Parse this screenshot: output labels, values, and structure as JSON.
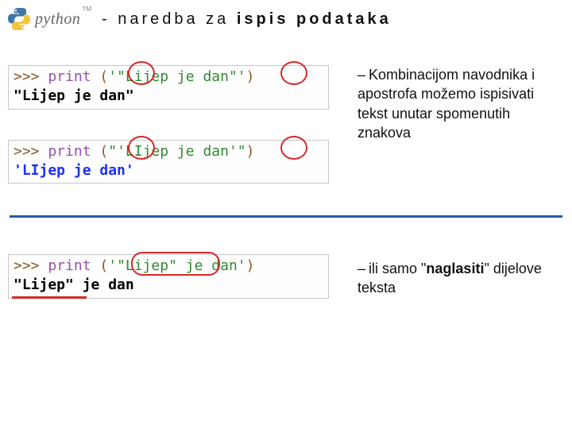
{
  "header": {
    "logo_word": "python",
    "tm": "TM",
    "title_before": "- naredba za ",
    "title_bold": "ispis podataka"
  },
  "code1": {
    "prompt": ">>> ",
    "kw": "print",
    "open": " (",
    "argA": "'\"Lijep je dan\"'",
    "close": ")",
    "outA": "\"Lijep je dan\"",
    "prompt2": ">>> ",
    "kw2": "print",
    "open2": " (",
    "argB": "\"'LIjep je dan'\"",
    "close2": ")",
    "outB": "'LIjep je dan'"
  },
  "note1": {
    "dash": "–",
    "body": "Kombinacijom navodnika i apostrofa možemo ispisivati tekst unutar spomenutih znakova"
  },
  "code2": {
    "prompt": ">>> ",
    "kw": "print",
    "open": " (",
    "argC": "'\"Lijep\" je dan'",
    "close": ")",
    "outC": "\"Lijep\" je dan"
  },
  "note2": {
    "dash": "–",
    "before": "ili samo ",
    "quote_left": "\"",
    "bold": "naglasiti",
    "quote_right": "\"",
    "after": " dijelove teksta"
  }
}
